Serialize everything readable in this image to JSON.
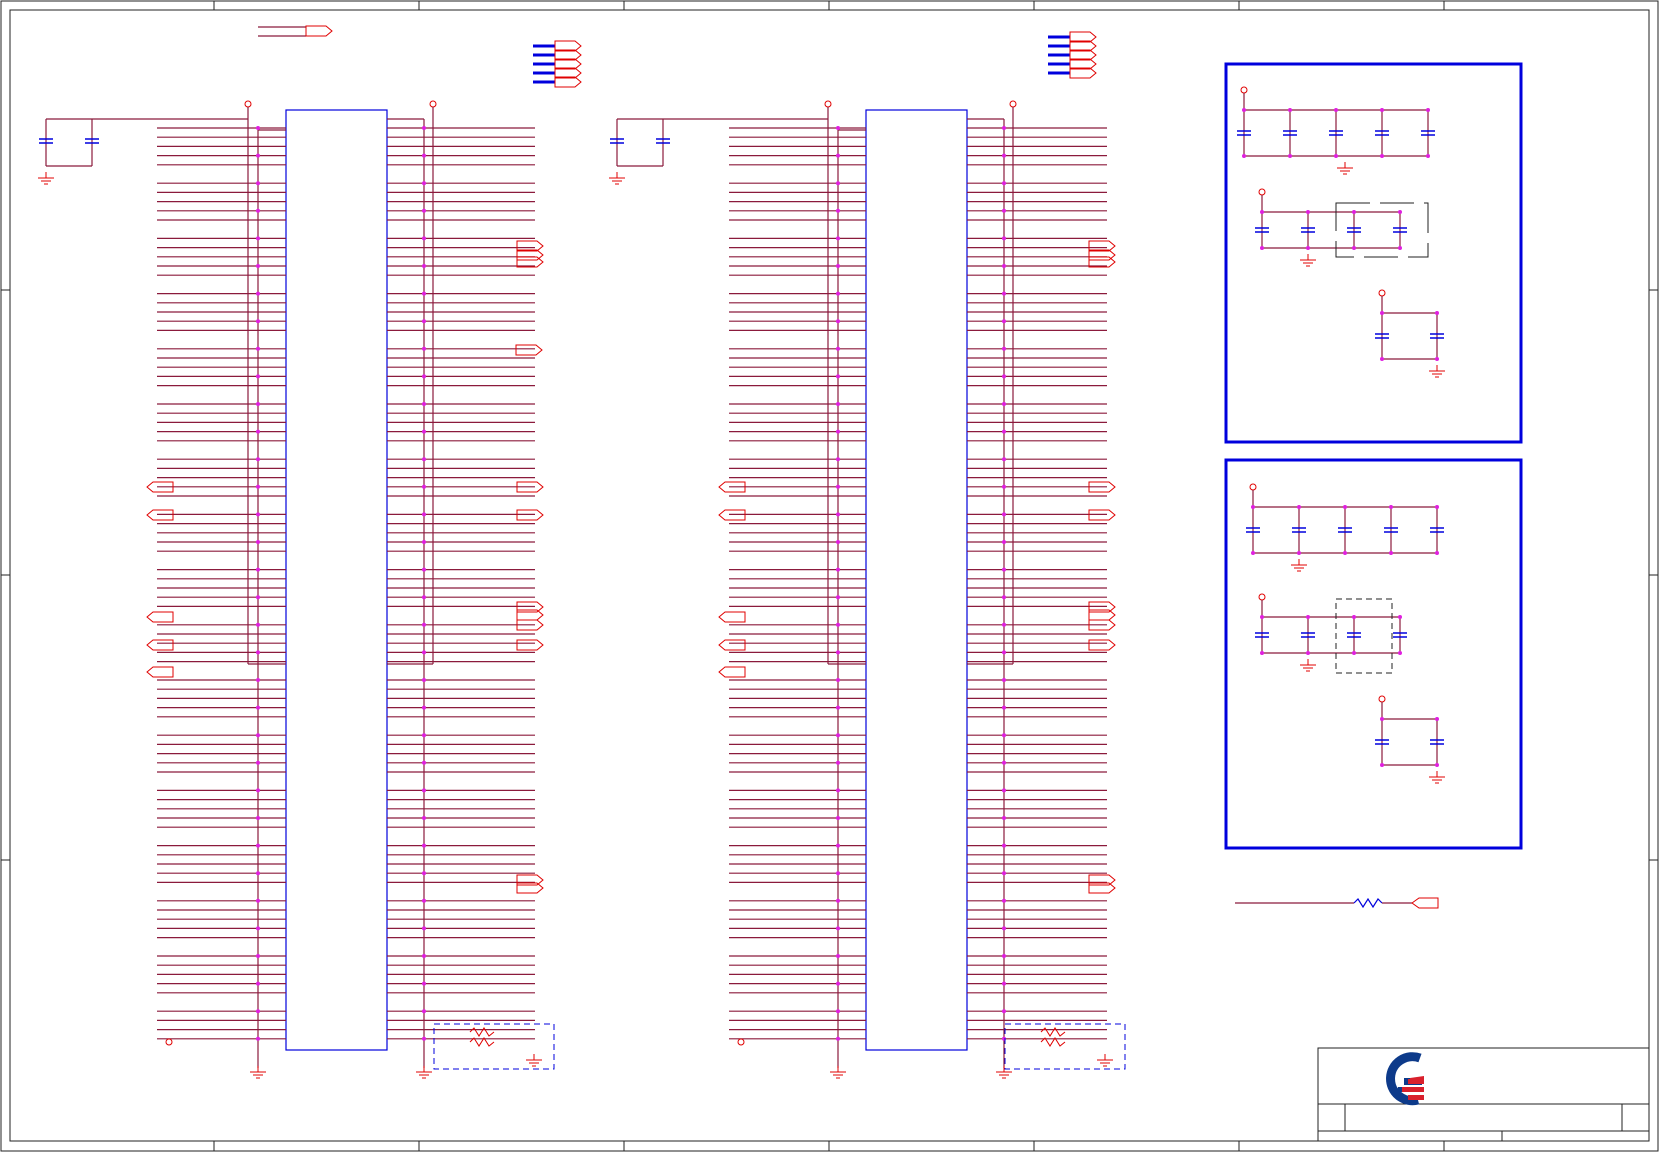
{
  "sheet": {
    "frame_color": "#222222",
    "wire_color": "#8b1a3c",
    "component_color": "#0000dd",
    "port_color": "#e00000",
    "junction_color": "#e020e0"
  },
  "title_block": {
    "logo": "quanta-logo",
    "logo_colors": [
      "#0d3a8a",
      "#d9202c"
    ]
  },
  "icons": [
    "capacitor-icon",
    "ground-icon",
    "resistor-icon",
    "port-flag-icon",
    "power-pin-icon"
  ]
}
